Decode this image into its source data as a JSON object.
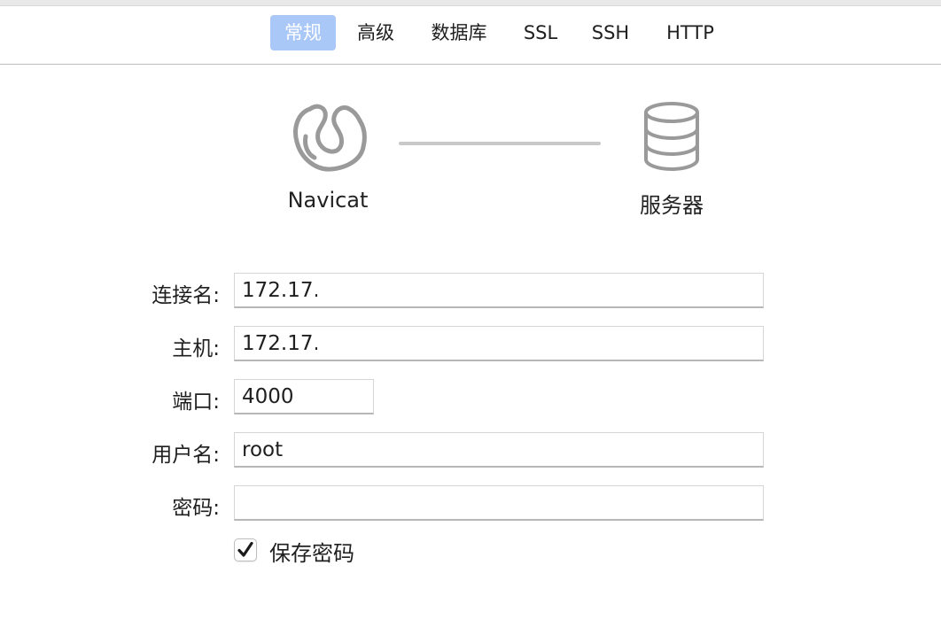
{
  "tabs": [
    {
      "label": "常规",
      "active": true
    },
    {
      "label": "高级",
      "active": false
    },
    {
      "label": "数据库",
      "active": false
    },
    {
      "label": "SSL",
      "active": false
    },
    {
      "label": "SSH",
      "active": false
    },
    {
      "label": "HTTP",
      "active": false
    }
  ],
  "diagram": {
    "client": {
      "label": "Navicat",
      "icon": "navicat-logo-icon"
    },
    "server": {
      "label": "服务器",
      "icon": "database-icon"
    }
  },
  "form": {
    "connection_name": {
      "label": "连接名:",
      "value": "172.17.("
    },
    "host": {
      "label": "主机:",
      "value": "172.17.("
    },
    "port": {
      "label": "端口:",
      "value": "4000"
    },
    "username": {
      "label": "用户名:",
      "value": "root"
    },
    "password": {
      "label": "密码:",
      "value": ""
    },
    "save_password": {
      "label": "保存密码",
      "checked": true
    }
  },
  "colors": {
    "active_tab": "#a9c7f7",
    "icon_gray": "#9a9a9a"
  }
}
